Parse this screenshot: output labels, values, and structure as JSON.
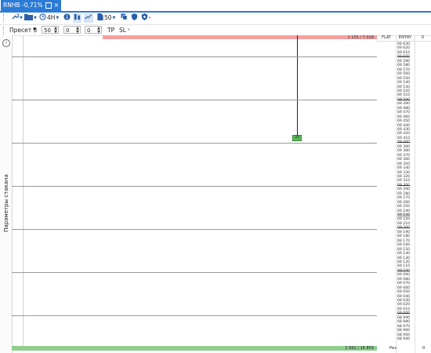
{
  "tab": {
    "title": "RNHB -0,71%",
    "close": "×"
  },
  "toolbar": {
    "timeframe": "4H",
    "volume": "50"
  },
  "params": {
    "preset_label": "Пресет 3",
    "field1": "50",
    "field2": "0",
    "field3": "0",
    "tp": "TP",
    "sl": "SL"
  },
  "sidebar": {
    "expand": "›",
    "label": "Параметры стакана"
  },
  "chart": {
    "top_volume": "1 155 / 7 018",
    "bottom_volume": "1 692 / 16 859",
    "marker": "35",
    "accent": "#2b7bd6",
    "sell": "#f3a0a0",
    "buy": "#8fce8f"
  },
  "dom": {
    "col_flat": "FLAT",
    "col_entry": "ENTRY",
    "col_zero": "0",
    "foot_label": "Рез",
    "foot_value": "0",
    "prices": [
      "69 630",
      "69 620",
      "69 610",
      "69 600",
      "69 590",
      "69 580",
      "69 570",
      "69 560",
      "69 550",
      "69 540",
      "69 530",
      "69 520",
      "69 510",
      "69 500",
      "69 490",
      "69 480",
      "69 470",
      "69 460",
      "69 450",
      "69 440",
      "69 430",
      "69 420",
      "69 410",
      "69 400",
      "69 390",
      "69 380",
      "69 370",
      "69 360",
      "69 350",
      "69 340",
      "69 330",
      "69 320",
      "69 310",
      "69 300",
      "69 290",
      "69 280",
      "69 270",
      "69 260",
      "69 250",
      "69 240",
      "69 230",
      "69 220",
      "69 210",
      "69 200",
      "69 190",
      "69 180",
      "69 170",
      "69 160",
      "69 150",
      "69 140",
      "69 130",
      "69 120",
      "69 110",
      "69 100",
      "69 090",
      "69 080",
      "69 070",
      "69 060",
      "69 050",
      "69 040",
      "69 030",
      "69 020",
      "69 010",
      "69 000",
      "68 990",
      "68 980",
      "68 970",
      "68 960",
      "68 950",
      "68 940"
    ],
    "highlight": "69 230"
  }
}
